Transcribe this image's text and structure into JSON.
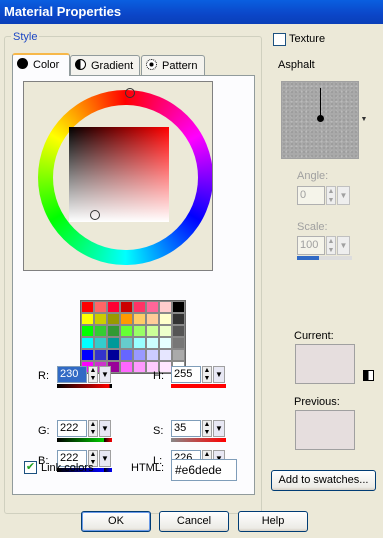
{
  "window": {
    "title": "Material Properties"
  },
  "style_group": {
    "label": "Style"
  },
  "tabs": [
    {
      "label": "Color",
      "active": true,
      "icon": "color-dot-icon"
    },
    {
      "label": "Gradient",
      "active": false,
      "icon": "gradient-icon"
    },
    {
      "label": "Pattern",
      "active": false,
      "icon": "pattern-icon"
    }
  ],
  "rgb": {
    "r_label": "R:",
    "r_value": "230",
    "g_label": "G:",
    "g_value": "222",
    "b_label": "B:",
    "b_value": "222"
  },
  "hsl": {
    "h_label": "H:",
    "h_value": "255",
    "s_label": "S:",
    "s_value": "35",
    "l_label": "L:",
    "l_value": "226"
  },
  "link_colors": {
    "label": "Link colors",
    "checked": true
  },
  "html_field": {
    "label": "HTML:",
    "value": "#e6dede"
  },
  "texture": {
    "label": "Texture",
    "checked": false,
    "name": "Asphalt",
    "angle_label": "Angle:",
    "angle_value": "0",
    "scale_label": "Scale:",
    "scale_value": "100"
  },
  "current": {
    "label": "Current:",
    "color": "#e6dede"
  },
  "previous": {
    "label": "Previous:",
    "color": "#e6dede"
  },
  "buttons": {
    "add_swatches": "Add to swatches...",
    "ok": "OK",
    "cancel": "Cancel",
    "help": "Help"
  },
  "palette": [
    "#ff0000",
    "#ff6666",
    "#ff0033",
    "#cc0000",
    "#ff3366",
    "#ff6699",
    "#ffcccc",
    "#000000",
    "#ffff00",
    "#cccc00",
    "#999900",
    "#ff9900",
    "#ffcc66",
    "#ffcc99",
    "#ffffcc",
    "#333333",
    "#00ff00",
    "#33cc33",
    "#339933",
    "#66ff33",
    "#99ff66",
    "#ccff99",
    "#eeffcc",
    "#555555",
    "#00ffff",
    "#33cccc",
    "#009999",
    "#66cccc",
    "#99ffff",
    "#ccffff",
    "#e6ffff",
    "#777777",
    "#0000ff",
    "#3333cc",
    "#000099",
    "#6666ff",
    "#9999ff",
    "#ccccff",
    "#e6e6ff",
    "#aaaaaa",
    "#ff00ff",
    "#cc33cc",
    "#990099",
    "#ff66ff",
    "#ff99ff",
    "#ffccff",
    "#ffe6ff",
    "#ffffff"
  ]
}
